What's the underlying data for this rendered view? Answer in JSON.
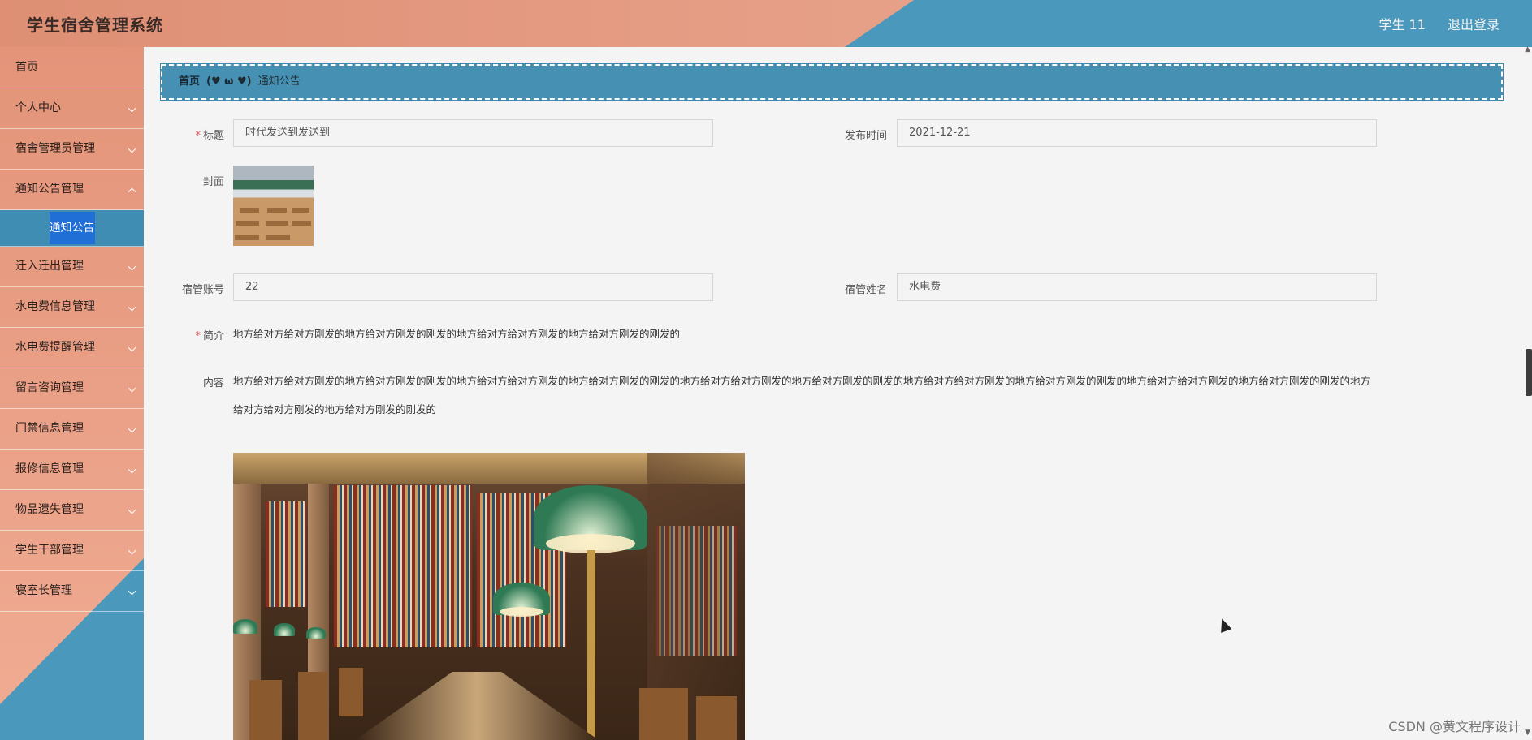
{
  "header": {
    "title": "学生宿舍管理系统",
    "user": "学生 11",
    "logout": "退出登录"
  },
  "sidebar": {
    "items": [
      {
        "label": "首页"
      },
      {
        "label": "个人中心"
      },
      {
        "label": "宿舍管理员管理"
      },
      {
        "label": "通知公告管理"
      },
      {
        "label": "通知公告"
      },
      {
        "label": "迁入迁出管理"
      },
      {
        "label": "水电费信息管理"
      },
      {
        "label": "水电费提醒管理"
      },
      {
        "label": "留言咨询管理"
      },
      {
        "label": "门禁信息管理"
      },
      {
        "label": "报修信息管理"
      },
      {
        "label": "物品遗失管理"
      },
      {
        "label": "学生干部管理"
      },
      {
        "label": "寝室长管理"
      }
    ]
  },
  "breadcrumb": {
    "home": "首页",
    "sep": "(♥ ω ♥)",
    "current": "通知公告"
  },
  "form": {
    "title_label": "标题",
    "title_value": "时代发送到发送到",
    "publish_label": "发布时间",
    "publish_value": "2021-12-21",
    "cover_label": "封面",
    "account_label": "宿管账号",
    "account_value": "22",
    "name_label": "宿管姓名",
    "name_value": "水电费",
    "summary_label": "简介",
    "summary_value": "地方给对方给对方刚发的地方给对方刚发的刚发的地方给对方给对方刚发的地方给对方刚发的刚发的",
    "content_label": "内容",
    "content_line1": "地方给对方给对方刚发的地方给对方刚发的刚发的地方给对方给对方刚发的地方给对方刚发的刚发的地方给对方给对方刚发的地方给对方刚发的刚发的地方给对方给对方刚发的地方给对方刚发的刚发的地方给对方给对方刚发的地方给对方刚发的刚发的地方",
    "content_line2": "给对方给对方刚发的地方给对方刚发的刚发的"
  },
  "watermark": "CSDN @黄文程序设计"
}
